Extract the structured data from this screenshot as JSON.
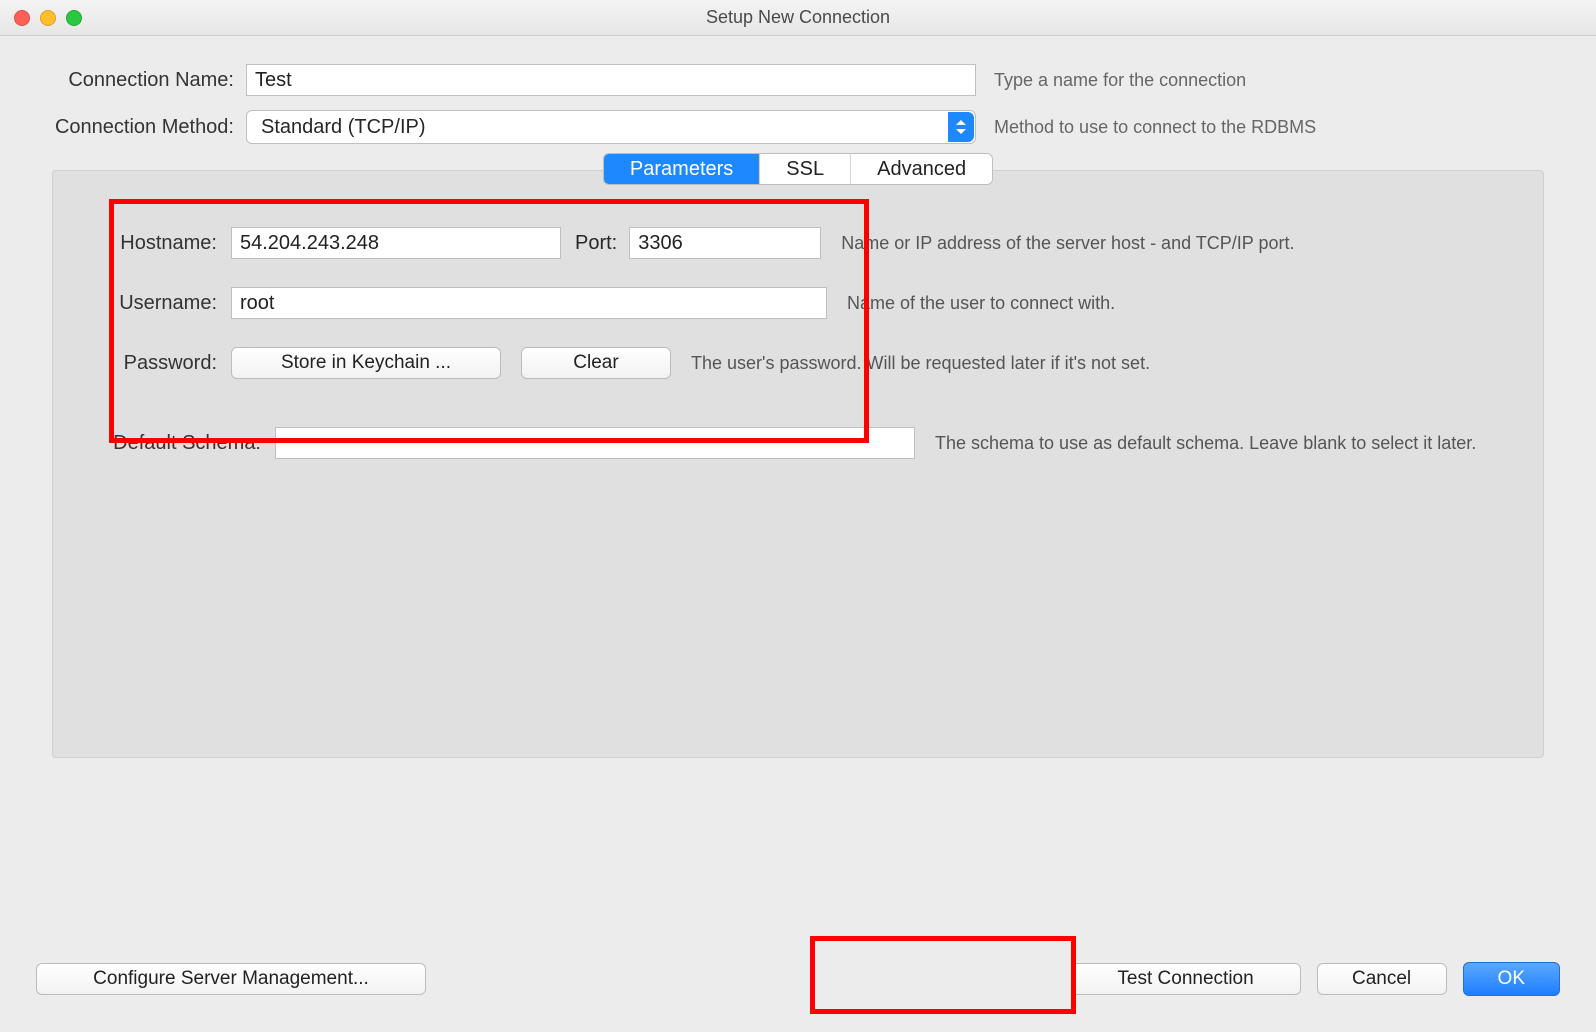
{
  "window": {
    "title": "Setup New Connection"
  },
  "top": {
    "name_label": "Connection Name:",
    "name_value": "Test",
    "name_help": "Type a name for the connection",
    "method_label": "Connection Method:",
    "method_value": "Standard (TCP/IP)",
    "method_help": "Method to use to connect to the RDBMS"
  },
  "tabs": {
    "parameters": "Parameters",
    "ssl": "SSL",
    "advanced": "Advanced"
  },
  "params": {
    "hostname_label": "Hostname:",
    "hostname_value": "54.204.243.248",
    "port_label": "Port:",
    "port_value": "3306",
    "hostname_help": "Name or IP address of the server host - and TCP/IP port.",
    "username_label": "Username:",
    "username_value": "root",
    "username_help": "Name of the user to connect with.",
    "password_label": "Password:",
    "store_btn": "Store in Keychain ...",
    "clear_btn": "Clear",
    "password_help": "The user's password. Will be requested later if it's not set.",
    "schema_label": "Default Schema:",
    "schema_value": "",
    "schema_help": "The schema to use as default schema. Leave blank to select it later."
  },
  "buttons": {
    "configure": "Configure Server Management...",
    "test": "Test Connection",
    "cancel": "Cancel",
    "ok": "OK"
  }
}
